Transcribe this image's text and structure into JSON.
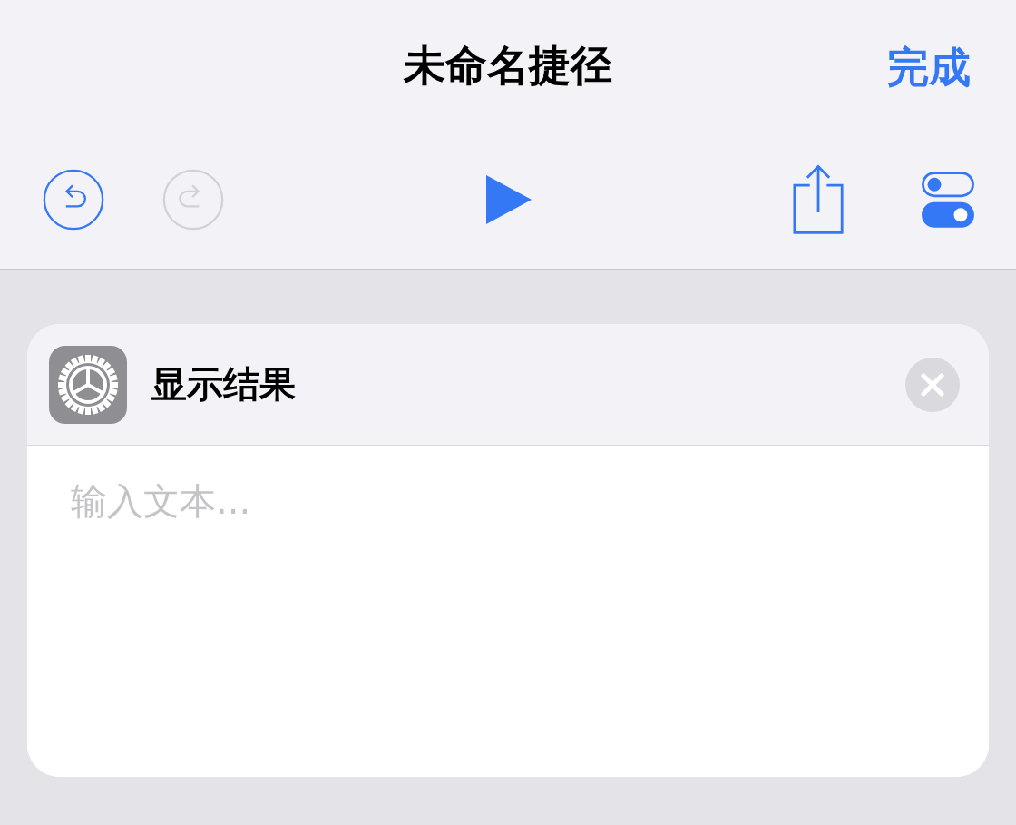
{
  "nav": {
    "title": "未命名捷径",
    "done": "完成"
  },
  "toolbar": {
    "undo": {
      "disabled": false
    },
    "redo": {
      "disabled": true
    }
  },
  "action": {
    "title": "显示结果",
    "text_field": {
      "placeholder": "输入文本..."
    }
  }
}
